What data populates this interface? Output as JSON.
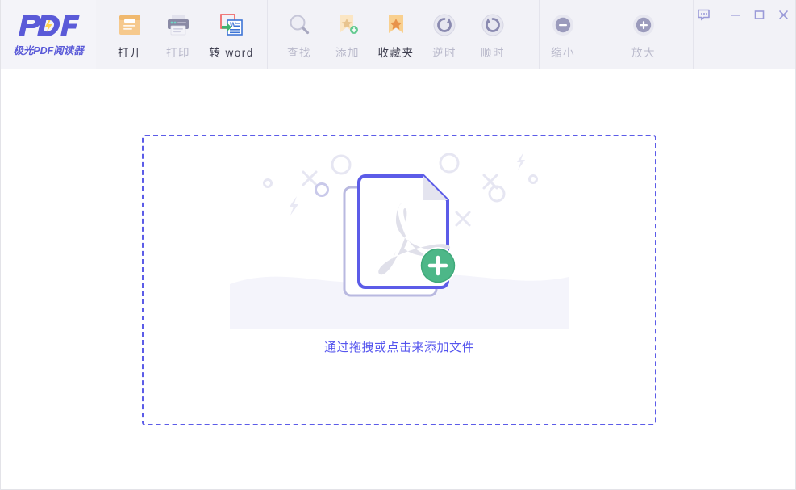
{
  "window": {
    "controls": [
      {
        "name": "feedback-icon",
        "label": "反馈"
      },
      {
        "name": "minimize-button",
        "label": "最小化"
      },
      {
        "name": "maximize-button",
        "label": "最大化"
      },
      {
        "name": "close-button",
        "label": "关闭"
      }
    ]
  },
  "logo": {
    "mark": "PDF",
    "subtitle": "极光PDF阅读器",
    "accent": "#5a5ad8"
  },
  "toolbar": {
    "background": "#f2f2f7",
    "items": [
      {
        "id": "open",
        "label": "打开",
        "icon": "open-document-icon",
        "disabled": false
      },
      {
        "id": "print",
        "label": "打印",
        "icon": "printer-icon",
        "disabled": true
      },
      {
        "id": "to-word",
        "label": "转 word",
        "icon": "convert-to-word-icon",
        "disabled": false
      },
      {
        "id": "search",
        "label": "查找",
        "icon": "magnifier-icon",
        "disabled": true
      },
      {
        "id": "add",
        "label": "添加",
        "icon": "add-bookmark-icon",
        "disabled": true
      },
      {
        "id": "favorites",
        "label": "收藏夹",
        "icon": "bookmark-star-icon",
        "disabled": false
      },
      {
        "id": "rotate-ccw",
        "label": "逆时",
        "icon": "rotate-ccw-icon",
        "disabled": true
      },
      {
        "id": "rotate-cw",
        "label": "顺时",
        "icon": "rotate-cw-icon",
        "disabled": true
      },
      {
        "id": "zoom-out",
        "label": "缩小",
        "icon": "minus-circle-icon",
        "disabled": true
      },
      {
        "id": "zoom-in",
        "label": "放大",
        "icon": "plus-circle-icon",
        "disabled": true
      }
    ]
  },
  "dropzone": {
    "hint": "通过拖拽或点击来添加文件",
    "border_color": "#5c5ce8",
    "text_color": "#5555ee",
    "illustration": {
      "name": "pdf-document-add-illustration",
      "doc_outline_color": "#5c5ce8",
      "badge_color": "#4db788",
      "badge_glyph": "+"
    }
  }
}
